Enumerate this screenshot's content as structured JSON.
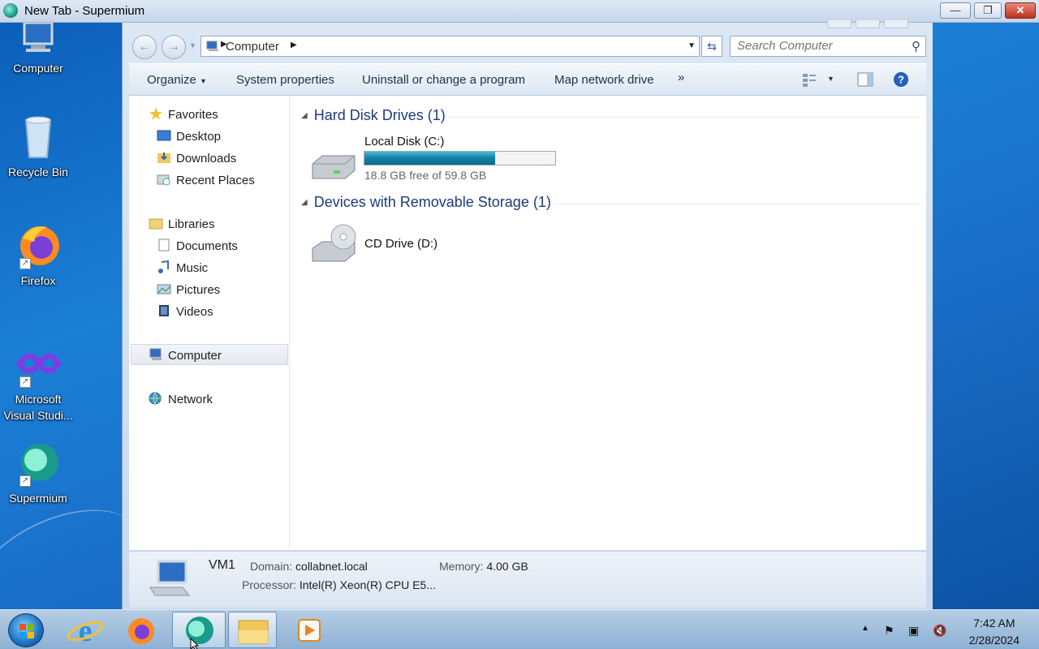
{
  "window": {
    "title": "New Tab - Supermium",
    "buttons": {
      "minimize": "—",
      "maximize": "❐",
      "close": "✕"
    }
  },
  "desktop": {
    "icons": [
      {
        "label": "Computer"
      },
      {
        "label": "Recycle Bin"
      },
      {
        "label": "Firefox"
      },
      {
        "label": "Microsoft Visual Studi..."
      },
      {
        "label": "Supermium"
      }
    ]
  },
  "explorer": {
    "address": {
      "segment": "Computer"
    },
    "search": {
      "placeholder": "Search Computer"
    },
    "commands": {
      "organize": "Organize",
      "system_properties": "System properties",
      "uninstall": "Uninstall or change a program",
      "map_drive": "Map network drive",
      "more": "»"
    },
    "nav": {
      "favorites": "Favorites",
      "desktop": "Desktop",
      "downloads": "Downloads",
      "recent_places": "Recent Places",
      "libraries": "Libraries",
      "documents": "Documents",
      "music": "Music",
      "pictures": "Pictures",
      "videos": "Videos",
      "computer": "Computer",
      "network": "Network"
    },
    "groups": {
      "hdd_header": "Hard Disk Drives (1)",
      "removable_header": "Devices with Removable Storage (1)"
    },
    "drives": {
      "c": {
        "name": "Local Disk (C:)",
        "free_text": "18.8 GB free of 59.8 GB",
        "used_fraction": 0.686
      },
      "d": {
        "name": "CD Drive (D:)"
      }
    },
    "details": {
      "name": "VM1",
      "domain_label": "Domain:",
      "domain": "collabnet.local",
      "memory_label": "Memory:",
      "memory": "4.00 GB",
      "processor_label": "Processor:",
      "processor": "Intel(R) Xeon(R) CPU E5..."
    }
  },
  "taskbar": {
    "clock": {
      "time": "7:42 AM",
      "date": "2/28/2024"
    }
  },
  "colors": {
    "accent": "#1e3a7a",
    "bar_fill": "#127fa6"
  }
}
